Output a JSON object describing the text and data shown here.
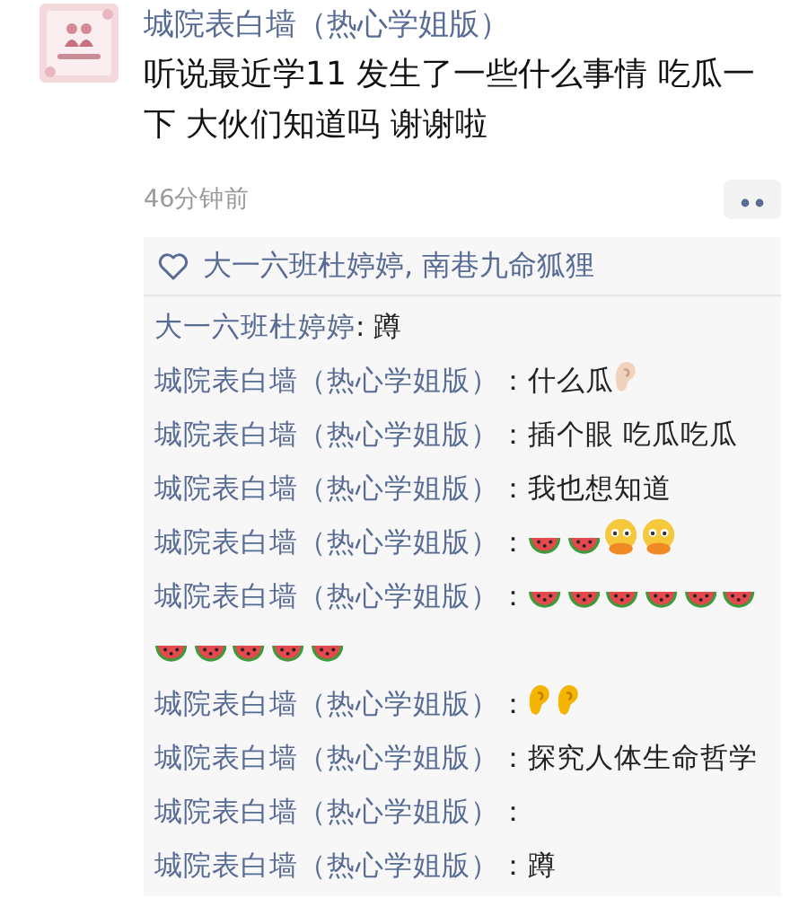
{
  "post": {
    "author": "城院表白墙（热心学姐版）",
    "text": "听说最近学11 发生了一些什么事情  吃瓜一下  大伙们知道吗  谢谢啦",
    "time": "46分钟前"
  },
  "likes": {
    "names": "大一六班杜婷婷, 南巷九命狐狸"
  },
  "comments": [
    {
      "author": "大一六班杜婷婷",
      "text": ": 蹲"
    },
    {
      "author": "城院表白墙（热心学姐版）",
      "text": "：什么瓜",
      "emoji": [
        {
          "kind": "ear-light"
        }
      ]
    },
    {
      "author": "城院表白墙（热心学姐版）",
      "text": "：插个眼 吃瓜吃瓜"
    },
    {
      "author": "城院表白墙（热心学姐版）",
      "text": "：我也想知道"
    },
    {
      "author": "城院表白墙（热心学姐版）",
      "text": "：",
      "emoji": [
        {
          "kind": "watermelon"
        },
        {
          "kind": "watermelon"
        },
        {
          "kind": "face"
        },
        {
          "kind": "face"
        }
      ]
    },
    {
      "author": "城院表白墙（热心学姐版）",
      "text": "：",
      "emoji": [
        {
          "kind": "watermelon"
        },
        {
          "kind": "watermelon"
        },
        {
          "kind": "watermelon"
        },
        {
          "kind": "watermelon"
        },
        {
          "kind": "watermelon"
        },
        {
          "kind": "watermelon"
        },
        {
          "kind": "watermelon"
        },
        {
          "kind": "watermelon"
        },
        {
          "kind": "watermelon"
        },
        {
          "kind": "watermelon"
        },
        {
          "kind": "watermelon"
        }
      ]
    },
    {
      "author": "城院表白墙（热心学姐版）",
      "text": "：",
      "emoji": [
        {
          "kind": "ear"
        },
        {
          "kind": "ear"
        }
      ]
    },
    {
      "author": "城院表白墙（热心学姐版）",
      "text": "：探究人体生命哲学"
    },
    {
      "author": "城院表白墙（热心学姐版）",
      "text": "："
    },
    {
      "author": "城院表白墙（热心学姐版）",
      "text": "：蹲"
    }
  ]
}
